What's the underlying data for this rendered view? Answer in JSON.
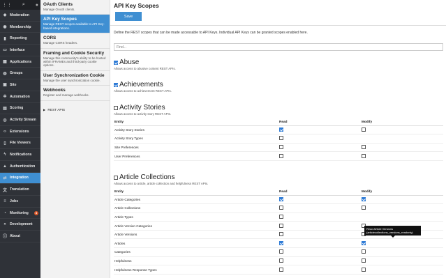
{
  "nav": {
    "items": [
      {
        "label": "Moderation",
        "icon": "shield-icon",
        "glyph": "◆"
      },
      {
        "label": "Membership",
        "icon": "users-icon",
        "glyph": "◉"
      },
      {
        "label": "Reporting",
        "icon": "bar-chart-icon",
        "glyph": "▮"
      },
      {
        "label": "Interface",
        "icon": "monitor-icon",
        "glyph": "▭"
      },
      {
        "label": "Applications",
        "icon": "grid-icon",
        "glyph": "▦"
      },
      {
        "label": "Groups",
        "icon": "group-icon",
        "glyph": "◍"
      },
      {
        "label": "Site",
        "icon": "window-icon",
        "glyph": "▣"
      },
      {
        "label": "Automation",
        "icon": "gear-icon",
        "glyph": "✲"
      },
      {
        "label": "Scoring",
        "icon": "scoring-icon",
        "glyph": "▤"
      },
      {
        "label": "Activity Stream",
        "icon": "stream-icon",
        "glyph": "◎"
      },
      {
        "label": "Extensions",
        "icon": "code-icon",
        "glyph": "‹›"
      },
      {
        "label": "File Viewers",
        "icon": "file-icon",
        "glyph": "▯"
      },
      {
        "label": "Notifications",
        "icon": "lightning-icon",
        "glyph": "ϟ"
      },
      {
        "label": "Authentication",
        "icon": "lock-icon",
        "glyph": "▲"
      },
      {
        "label": "Integration",
        "icon": "shuffle-icon",
        "glyph": "⇄"
      },
      {
        "label": "Translation",
        "icon": "translate-icon",
        "glyph": "文"
      },
      {
        "label": "Jobs",
        "icon": "list-icon",
        "glyph": "≡"
      },
      {
        "label": "Monitoring",
        "icon": "gauge-icon",
        "glyph": "◔"
      },
      {
        "label": "Development",
        "icon": "terminal-icon",
        "glyph": "»"
      },
      {
        "label": "About",
        "icon": "info-icon",
        "glyph": "ⓘ"
      }
    ],
    "active_index": 14,
    "monitoring_badge": "3"
  },
  "subnav": {
    "items": [
      {
        "title": "OAuth Clients",
        "desc": "Manage OAuth clients."
      },
      {
        "title": "API Key Scopes",
        "desc": "Manage REST scopes available to API Key-based integrations."
      },
      {
        "title": "CORS",
        "desc": "Manage CORS headers."
      },
      {
        "title": "Framing and Cookie Security",
        "desc": "Manage this community's ability to be hosted within IFRAMEs and third-party cookie options."
      },
      {
        "title": "User Synchronization Cookie",
        "desc": "Manage the user synchronization cookie."
      },
      {
        "title": "Webhooks",
        "desc": "Register and manage webhooks."
      }
    ],
    "active_index": 1,
    "rest_link": "REST APIS"
  },
  "page": {
    "title": "API Key Scopes",
    "save_label": "Save",
    "intro": "Define the REST scopes that can be made accessable to API Keys. Individual API Keys can be granted scopes enabled here.",
    "find_placeholder": "Find..."
  },
  "sections": [
    {
      "title": "Abuse",
      "desc": "Allows access to abusive content REST APIs.",
      "checked": true,
      "rows": []
    },
    {
      "title": "Achievements",
      "desc": "Allows access to achievement REST APIs.",
      "checked": true,
      "rows": []
    },
    {
      "title": "Activity Stories",
      "desc": "Allows access to activity story REST APIs.",
      "checked": false,
      "columns": [
        "Entity",
        "Read",
        "Modify"
      ],
      "rows": [
        {
          "entity": "Activity Story Stories",
          "read": true,
          "modify": false,
          "has_modify": true
        },
        {
          "entity": "Activity Story Types",
          "read": false,
          "modify": false,
          "has_modify": false
        },
        {
          "entity": "Site Preferences",
          "read": false,
          "modify": false,
          "has_modify": true
        },
        {
          "entity": "User Preferences",
          "read": false,
          "modify": false,
          "has_modify": true
        }
      ]
    },
    {
      "title": "Article Collections",
      "desc": "Allows access to article, article collection and helpfulness REST APIs.",
      "checked": false,
      "columns": [
        "Entity",
        "Read",
        "Modify"
      ],
      "rows": [
        {
          "entity": "Article Categories",
          "read": true,
          "modify": true,
          "has_modify": true
        },
        {
          "entity": "Article Collections",
          "read": false,
          "modify": false,
          "has_modify": true
        },
        {
          "entity": "Article Types",
          "read": false,
          "modify": false,
          "has_modify": false
        },
        {
          "entity": "Article Version Categories",
          "read": false,
          "modify": false,
          "has_modify": true
        },
        {
          "entity": "Article Versions",
          "read": false,
          "modify": false,
          "has_modify": true
        },
        {
          "entity": "Articles",
          "read": true,
          "modify": true,
          "has_modify": true
        },
        {
          "entity": "Categories",
          "read": false,
          "modify": false,
          "has_modify": true
        },
        {
          "entity": "Helpfulness",
          "read": false,
          "modify": false,
          "has_modify": true
        },
        {
          "entity": "Helpfulness Response Types",
          "read": false,
          "modify": false,
          "has_modify": true
        }
      ]
    }
  ],
  "tooltip": {
    "line1": "Read Article Versions",
    "line2": "(articlecollections_versions_readonly)"
  }
}
